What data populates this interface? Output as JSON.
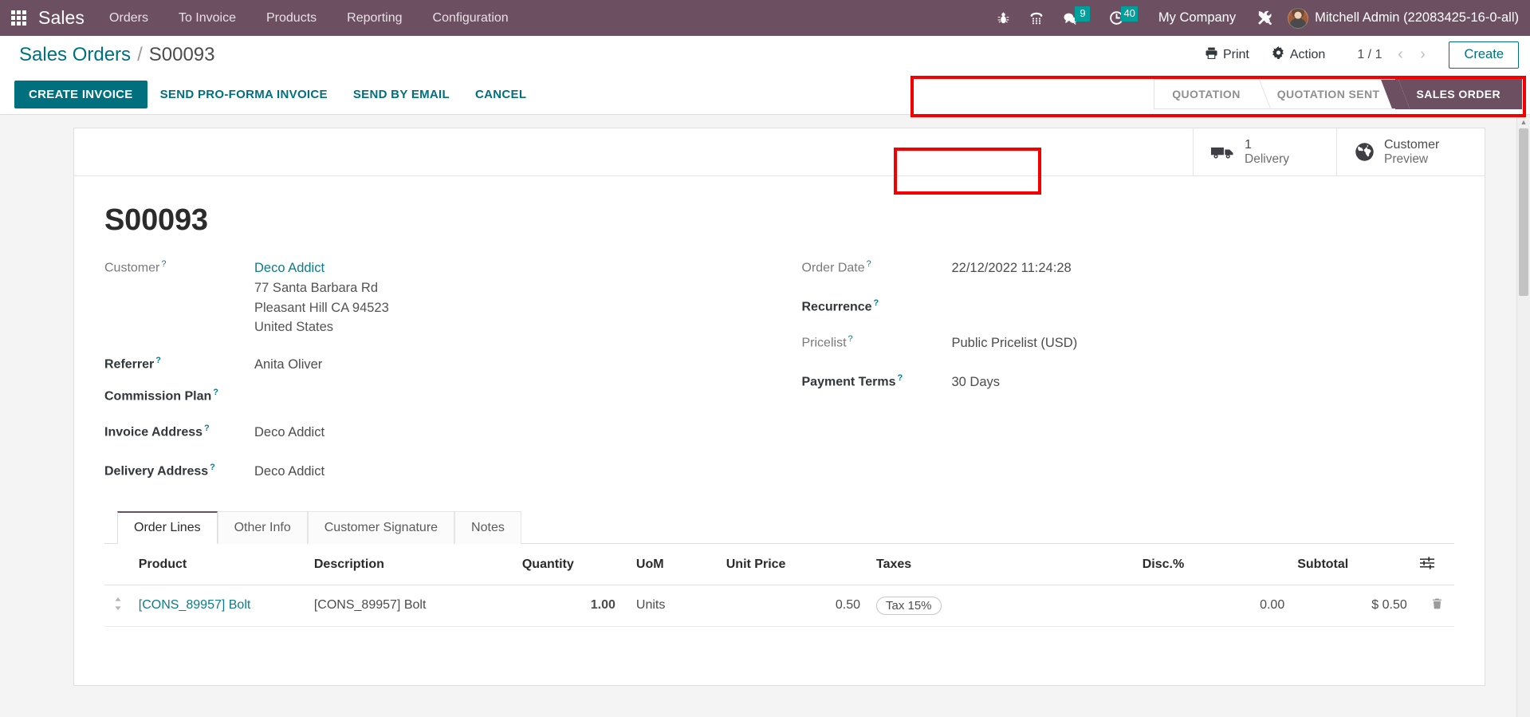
{
  "navbar": {
    "apps_icon": "apps-grid-icon",
    "brand": "Sales",
    "menu": [
      {
        "label": "Orders"
      },
      {
        "label": "To Invoice"
      },
      {
        "label": "Products"
      },
      {
        "label": "Reporting"
      },
      {
        "label": "Configuration"
      }
    ],
    "sys_icons": [
      {
        "name": "bug-icon"
      },
      {
        "name": "dialpad-icon"
      },
      {
        "name": "messages-icon",
        "count": "9"
      },
      {
        "name": "activities-clock-icon",
        "count": "40"
      }
    ],
    "company": "My Company",
    "tools_icon": "tools-icon",
    "user": "Mitchell Admin (22083425-16-0-all)",
    "background": "#6d4f62",
    "badge_color": "#00a09d"
  },
  "control_panel": {
    "breadcrumb": {
      "parent": "Sales Orders",
      "separator": "/",
      "current": "S00093"
    },
    "print_label": "Print",
    "action_label": "Action",
    "pager": "1 / 1",
    "create_label": "Create",
    "buttons": [
      {
        "label": "CREATE INVOICE",
        "primary": true
      },
      {
        "label": "SEND PRO-FORMA INVOICE",
        "primary": false
      },
      {
        "label": "SEND BY EMAIL",
        "primary": false
      },
      {
        "label": "CANCEL",
        "primary": false
      }
    ],
    "statusbar": [
      {
        "label": "QUOTATION",
        "active": false
      },
      {
        "label": "QUOTATION SENT",
        "active": false
      },
      {
        "label": "SALES ORDER",
        "active": true
      }
    ],
    "accent_color": "#00707f",
    "annotation_color": "#f40000"
  },
  "smart_buttons": [
    {
      "icon": "truck-icon",
      "value": "1",
      "label": "Delivery"
    },
    {
      "icon": "globe-icon",
      "value": "Customer",
      "label": "Preview"
    }
  ],
  "record": {
    "title": "S00093",
    "left_fields": [
      {
        "label": "Customer",
        "help": "?",
        "value": "Deco Addict",
        "link": true,
        "strong": false
      },
      {
        "label": "Referrer",
        "help": "?",
        "value": "Anita Oliver",
        "link": false,
        "strong": true
      },
      {
        "label": "Commission Plan",
        "help": "?",
        "value": "",
        "link": false,
        "strong": true
      },
      {
        "label": "Invoice Address",
        "help": "?",
        "value": "Deco Addict",
        "link": false,
        "strong": true
      },
      {
        "label": "Delivery Address",
        "help": "?",
        "value": "Deco Addict",
        "link": false,
        "strong": true
      }
    ],
    "address": [
      "77 Santa Barbara Rd",
      "Pleasant Hill CA 94523",
      "United States"
    ],
    "right_fields": [
      {
        "label": "Order Date",
        "help": "?",
        "value": "22/12/2022 11:24:28",
        "strong": false
      },
      {
        "label": "Recurrence",
        "help": "?",
        "value": "",
        "strong": true
      },
      {
        "label": "Pricelist",
        "help": "?",
        "value": "Public Pricelist (USD)",
        "strong": false
      },
      {
        "label": "Payment Terms",
        "help": "?",
        "value": "30 Days",
        "strong": true
      }
    ]
  },
  "notebook": {
    "tabs": [
      {
        "label": "Order Lines",
        "active": true
      },
      {
        "label": "Other Info",
        "active": false
      },
      {
        "label": "Customer Signature",
        "active": false
      },
      {
        "label": "Notes",
        "active": false
      }
    ],
    "columns": {
      "product": "Product",
      "description": "Description",
      "quantity": "Quantity",
      "uom": "UoM",
      "unit_price": "Unit Price",
      "taxes": "Taxes",
      "discount": "Disc.%",
      "subtotal": "Subtotal",
      "optional_icon": "column-options-icon"
    },
    "rows": [
      {
        "handle_icon": "drag-handle-icon",
        "product": "[CONS_89957] Bolt",
        "description": "[CONS_89957] Bolt",
        "quantity": "1.00",
        "uom": "Units",
        "unit_price": "0.50",
        "tax": "Tax 15%",
        "discount": "0.00",
        "subtotal": "$ 0.50",
        "delete_icon": "trash-icon"
      }
    ]
  }
}
